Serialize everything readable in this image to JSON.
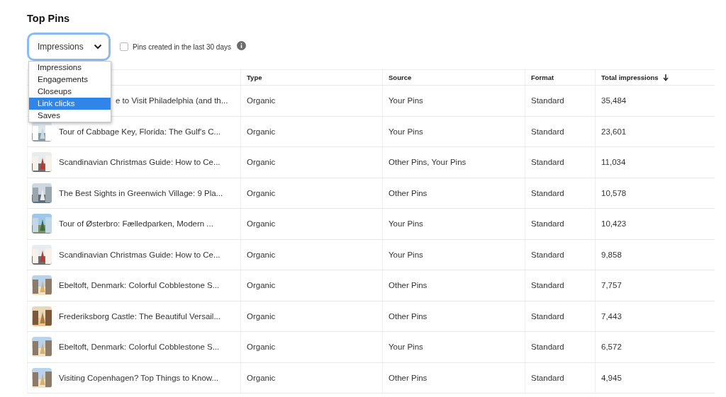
{
  "title": "Top Pins",
  "metric_select": {
    "value": "Impressions",
    "open": true,
    "options": [
      {
        "label": "Impressions",
        "highlighted": false
      },
      {
        "label": "Engagements",
        "highlighted": false
      },
      {
        "label": "Closeups",
        "highlighted": false
      },
      {
        "label": "Link clicks",
        "highlighted": true
      },
      {
        "label": "Saves",
        "highlighted": false
      }
    ]
  },
  "recent_filter": {
    "label": "Pins created in the last 30 days",
    "checked": false
  },
  "table": {
    "columns": [
      {
        "label": "Type",
        "sorted": false
      },
      {
        "label": "Source",
        "sorted": false
      },
      {
        "label": "Format",
        "sorted": false
      },
      {
        "label": "Total impressions",
        "sorted": true
      }
    ],
    "rows": [
      {
        "title": "e to Visit Philadelphia (and th...",
        "covered": true,
        "type": "Organic",
        "source": "Your Pins",
        "format": "Standard",
        "total": "35,484"
      },
      {
        "title": "Tour of Cabbage Key, Florida: The Gulf's C...",
        "covered": false,
        "type": "Organic",
        "source": "Your Pins",
        "format": "Standard",
        "total": "23,601"
      },
      {
        "title": "Scandinavian Christmas Guide: How to Ce...",
        "covered": false,
        "type": "Organic",
        "source": "Other Pins, Your Pins",
        "format": "Standard",
        "total": "11,034"
      },
      {
        "title": "The Best Sights in Greenwich Village: 9 Pla...",
        "covered": false,
        "type": "Organic",
        "source": "Other Pins",
        "format": "Standard",
        "total": "10,578"
      },
      {
        "title": "Tour of Østerbro: Fælledparken, Modern ...",
        "covered": false,
        "type": "Organic",
        "source": "Your Pins",
        "format": "Standard",
        "total": "10,423"
      },
      {
        "title": "Scandinavian Christmas Guide: How to Ce...",
        "covered": false,
        "type": "Organic",
        "source": "Your Pins",
        "format": "Standard",
        "total": "9,858"
      },
      {
        "title": "Ebeltoft, Denmark: Colorful Cobblestone S...",
        "covered": false,
        "type": "Organic",
        "source": "Other Pins",
        "format": "Standard",
        "total": "7,757"
      },
      {
        "title": "Frederiksborg Castle: The Beautiful Versail...",
        "covered": false,
        "type": "Organic",
        "source": "Other Pins",
        "format": "Standard",
        "total": "7,443"
      },
      {
        "title": "Ebeltoft, Denmark: Colorful Cobblestone S...",
        "covered": false,
        "type": "Organic",
        "source": "Your Pins",
        "format": "Standard",
        "total": "6,572"
      },
      {
        "title": "Visiting Copenhagen? Top Things to Know...",
        "covered": false,
        "type": "Organic",
        "source": "Other Pins",
        "format": "Standard",
        "total": "4,945"
      }
    ]
  }
}
